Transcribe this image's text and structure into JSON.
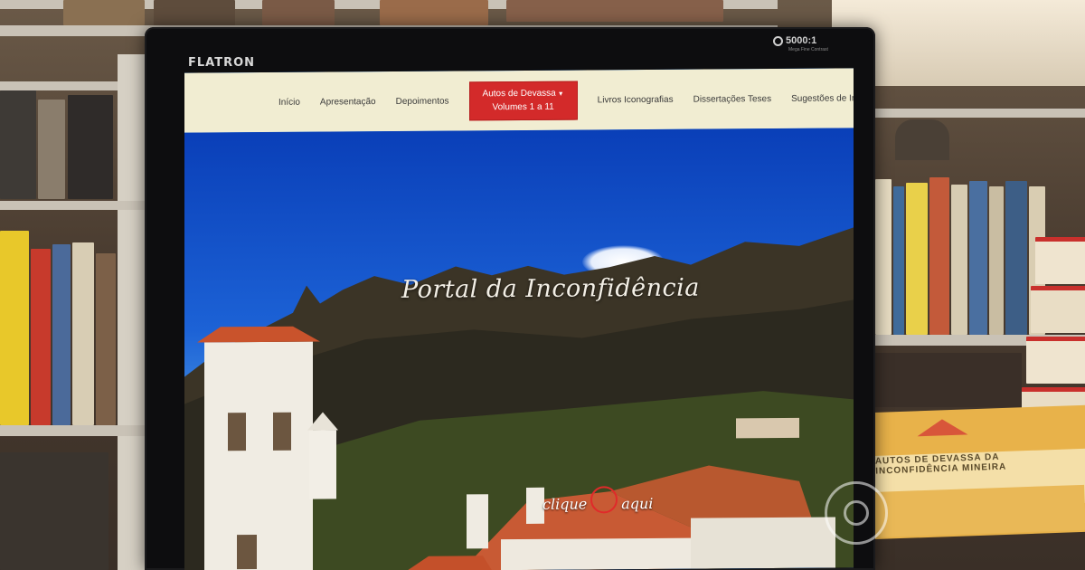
{
  "monitor": {
    "brand": "FLATRON",
    "contrast_badge": "5000:1",
    "contrast_subtext": "Mega Fine Contrast"
  },
  "site": {
    "nav": {
      "items": [
        "Início",
        "Apresentação",
        "Depoimentos"
      ],
      "dropdown": {
        "label": "Autos de Devassa",
        "sublabel": "Volumes 1 a 11"
      },
      "items_after": [
        "Livros Iconografias",
        "Dissertações Teses",
        "Sugestões de Inserção"
      ]
    },
    "hero": {
      "title": "Portal da Inconfidência",
      "cta_left": "clique",
      "cta_right": "aqui"
    }
  },
  "book": {
    "cover_text": "AUTOS DE DEVASSA DA INCONFIDÊNCIA MINEIRA"
  },
  "colors": {
    "nav_bg": "#f1edd2",
    "dropdown_red": "#d32a2a",
    "sky_blue": "#1c62d6",
    "cta_ring": "#e02a2a"
  },
  "icons": {
    "dropdown_caret": "caret-down-icon",
    "cta_ring": "circle-icon",
    "broadcaster_logo": "globe-logo-icon"
  }
}
